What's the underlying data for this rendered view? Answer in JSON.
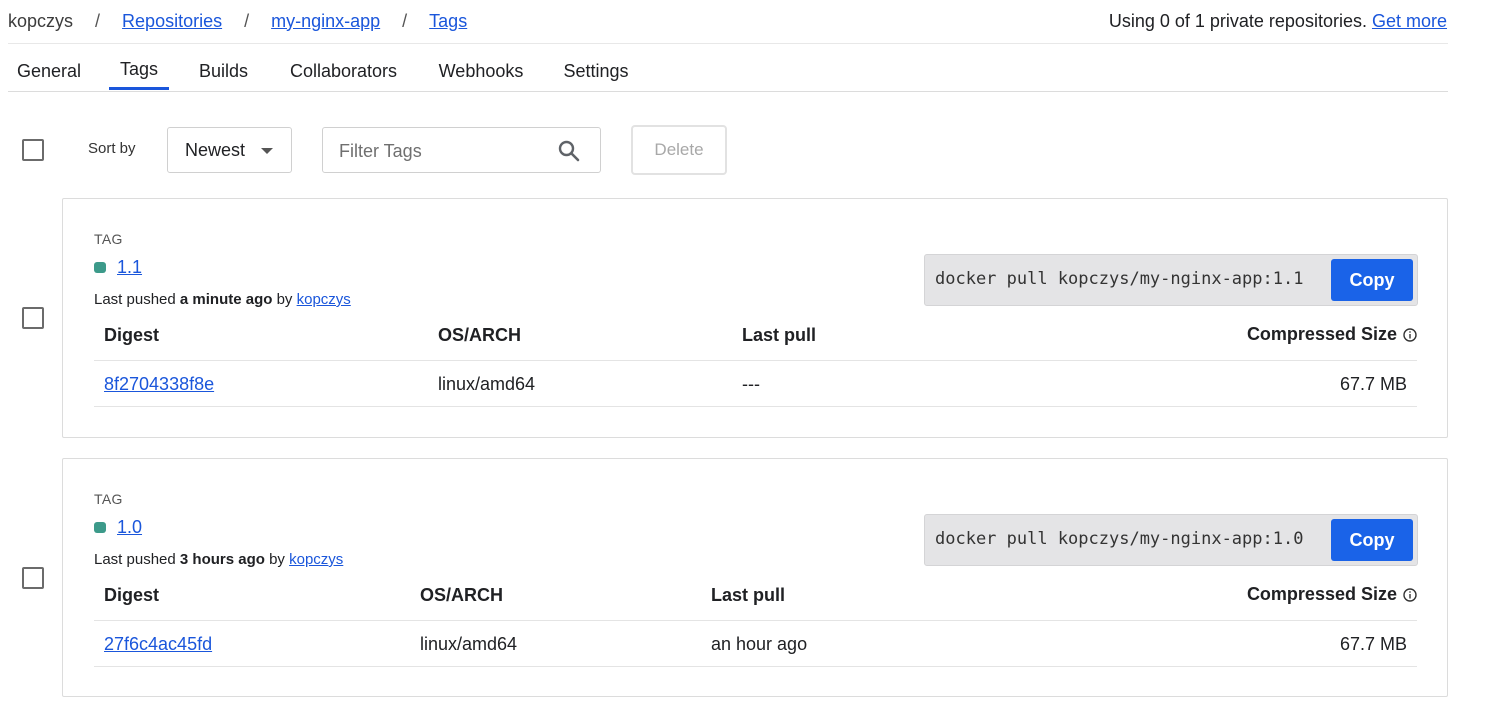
{
  "breadcrumb": {
    "owner": "kopczys",
    "separator": "/",
    "repositories": "Repositories",
    "repo": "my-nginx-app",
    "current": "Tags"
  },
  "quota": {
    "text": "Using 0 of 1 private repositories.",
    "link": "Get more"
  },
  "tabs": [
    "General",
    "Tags",
    "Builds",
    "Collaborators",
    "Webhooks",
    "Settings"
  ],
  "active_tab": "Tags",
  "toolbar": {
    "sort_label": "Sort by",
    "sort_value": "Newest",
    "filter_placeholder": "Filter Tags",
    "delete_label": "Delete"
  },
  "table_headers": {
    "digest": "Digest",
    "os_arch": "OS/ARCH",
    "last_pull": "Last pull",
    "compressed_size": "Compressed Size"
  },
  "tags": [
    {
      "label": "TAG",
      "name": "1.1",
      "pushed_prefix": "Last pushed",
      "pushed_when": "a minute ago",
      "pushed_by": "by",
      "pushed_user": "kopczys",
      "pull_command": "docker pull kopczys/my-nginx-app:1.1",
      "copy_label": "Copy",
      "digest": "8f2704338f8e",
      "os_arch": "linux/amd64",
      "last_pull": "---",
      "size": "67.7 MB"
    },
    {
      "label": "TAG",
      "name": "1.0",
      "pushed_prefix": "Last pushed",
      "pushed_when": "3 hours ago",
      "pushed_by": "by",
      "pushed_user": "kopczys",
      "pull_command": "docker pull kopczys/my-nginx-app:1.0",
      "copy_label": "Copy",
      "digest": "27f6c4ac45fd",
      "os_arch": "linux/amd64",
      "last_pull": "an hour ago",
      "size": "67.7 MB"
    }
  ],
  "colors": {
    "link": "#1a56db",
    "copy_button": "#1a63e8",
    "tag_status_dot": "#3c9a8a",
    "active_tab_underline": "#1a56db"
  },
  "icons": {
    "search": "search-icon",
    "dropdown": "chevron-down-icon",
    "info": "info-icon"
  }
}
